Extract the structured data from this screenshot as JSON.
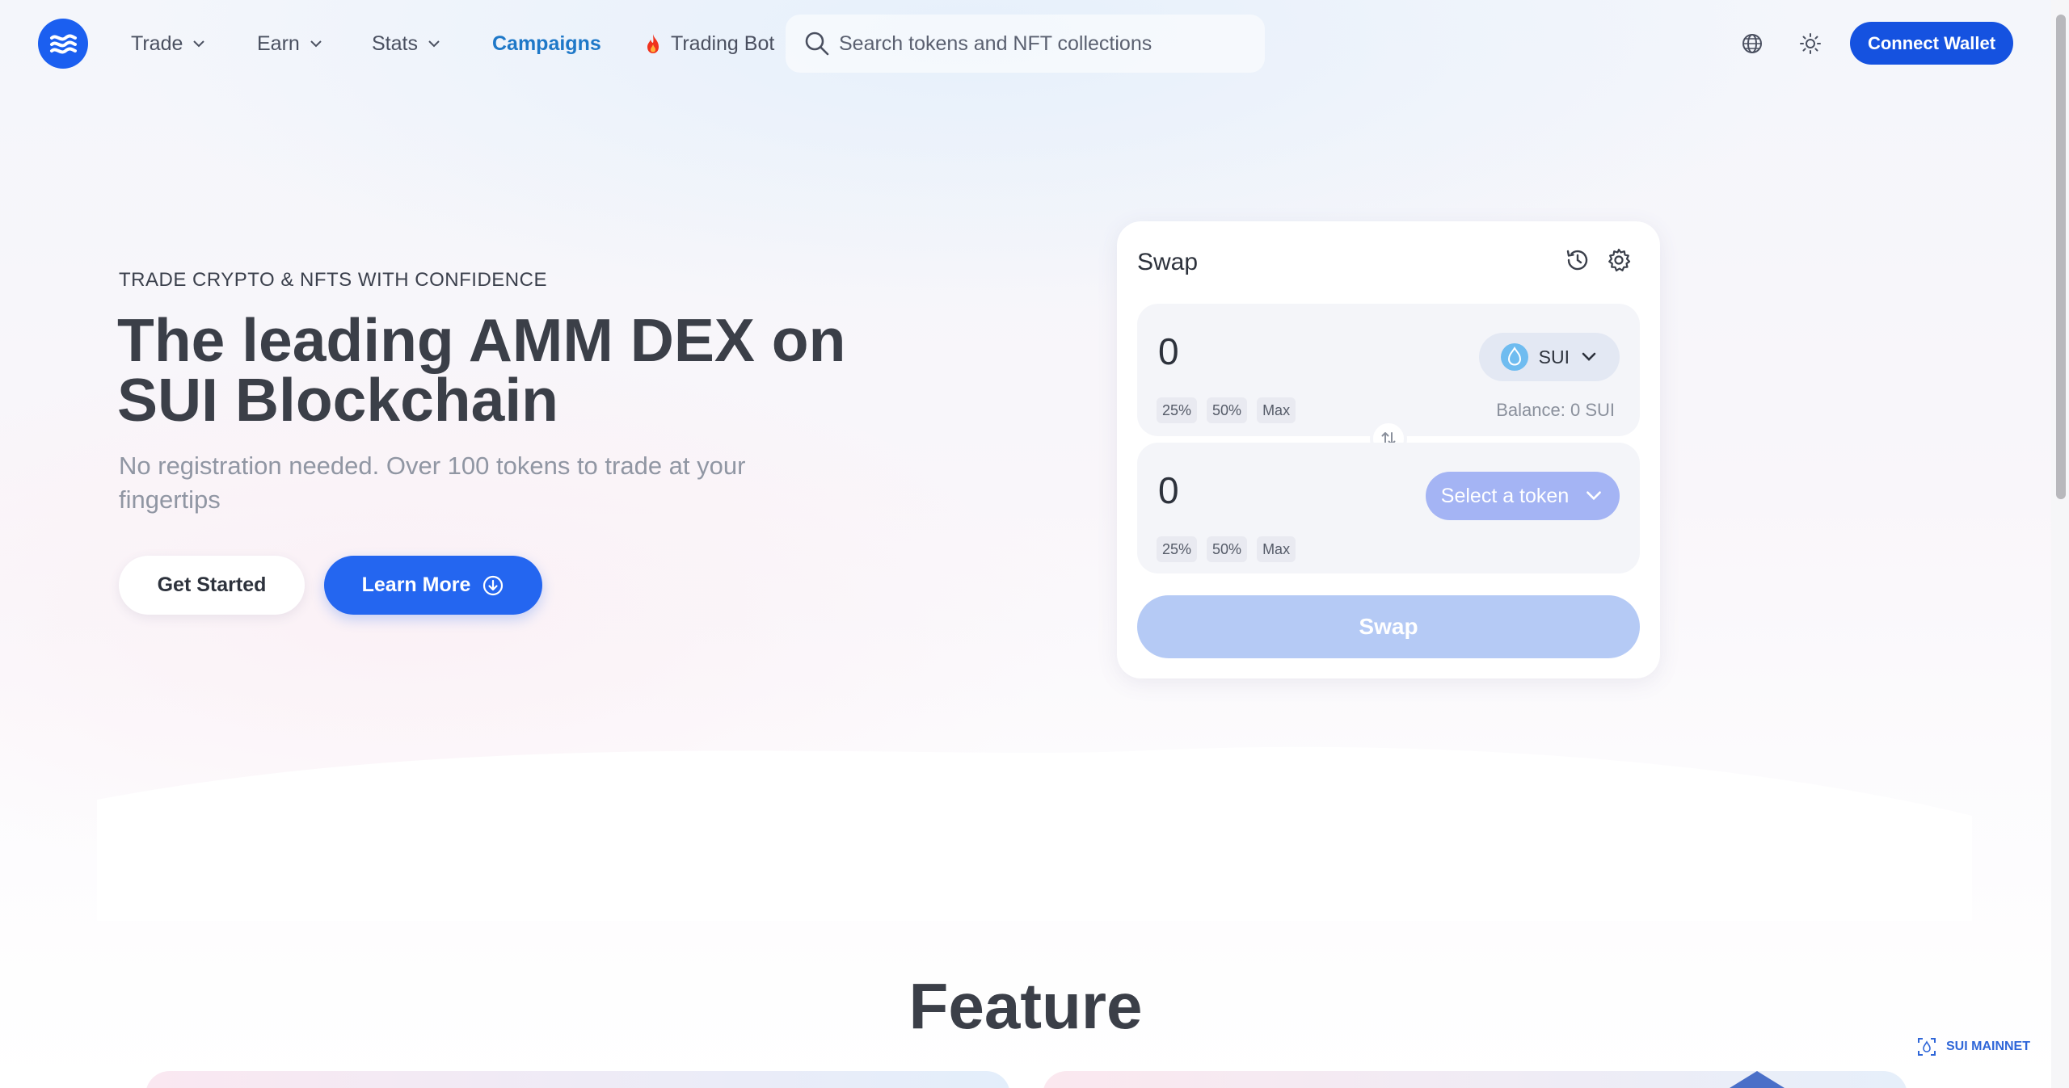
{
  "nav": {
    "items": [
      {
        "label": "Trade",
        "has_dropdown": true
      },
      {
        "label": "Earn",
        "has_dropdown": true
      },
      {
        "label": "Stats",
        "has_dropdown": true
      },
      {
        "label": "Campaigns",
        "has_dropdown": false
      },
      {
        "label": "Trading Bot",
        "has_dropdown": false
      }
    ],
    "search_placeholder": "Search tokens and NFT collections",
    "connect_label": "Connect Wallet"
  },
  "hero": {
    "eyebrow": "TRADE CRYPTO & NFTS WITH CONFIDENCE",
    "headline": "The leading AMM DEX on SUI Blockchain",
    "subline": "No registration needed. Over 100 tokens to trade at your fingertips",
    "get_started_label": "Get Started",
    "learn_more_label": "Learn More"
  },
  "swap": {
    "title": "Swap",
    "from": {
      "amount": "0",
      "token": "SUI",
      "balance": "Balance: 0 SUI",
      "pct_buttons": [
        "25%",
        "50%",
        "Max"
      ]
    },
    "to": {
      "amount": "0",
      "select_label": "Select a token",
      "pct_buttons": [
        "25%",
        "50%",
        "Max"
      ]
    },
    "button_label": "Swap"
  },
  "feature": {
    "title": "Feature"
  },
  "network": {
    "label": "SUI MAINNET"
  },
  "colors": {
    "brand": "#1b5ff0",
    "connect": "#1552e0",
    "campaigns": "#1e78c8",
    "swap_disabled": "#b5caf5",
    "select_token": "#a4b4f4"
  }
}
